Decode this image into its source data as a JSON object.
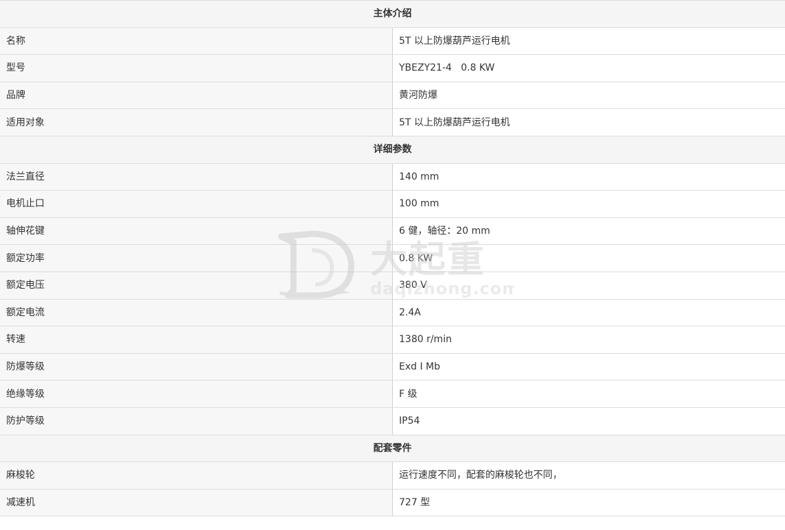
{
  "sections": [
    {
      "title": "主体介绍",
      "rows": [
        {
          "label": "名称",
          "value": "5T 以上防爆葫芦运行电机"
        },
        {
          "label": "型号",
          "value": "YBEZY21-4   0.8 KW"
        },
        {
          "label": "品牌",
          "value": "黄河防爆"
        },
        {
          "label": "适用对象",
          "value": "5T 以上防爆葫芦运行电机"
        }
      ]
    },
    {
      "title": "详细参数",
      "rows": [
        {
          "label": "法兰直径",
          "value": "140 mm"
        },
        {
          "label": "电机止口",
          "value": "100 mm"
        },
        {
          "label": "轴伸花键",
          "value": "6 健，轴径：20 mm"
        },
        {
          "label": "额定功率",
          "value": "0.8 KW"
        },
        {
          "label": "额定电压",
          "value": "380 V"
        },
        {
          "label": "额定电流",
          "value": "2.4A"
        },
        {
          "label": "转速",
          "value": "1380 r/min"
        },
        {
          "label": "防爆等级",
          "value": "Exd I Mb"
        },
        {
          "label": "绝缘等级",
          "value": "F 级"
        },
        {
          "label": "防护等级",
          "value": "IP54"
        }
      ]
    },
    {
      "title": "配套零件",
      "rows": [
        {
          "label": "麻梭轮",
          "value": "运行速度不同，配套的麻梭轮也不同，"
        },
        {
          "label": "减速机",
          "value": "727 型"
        }
      ]
    }
  ],
  "watermark": {
    "brand_text": "大起重",
    "domain_text": "daqizhong.com",
    "icon": "dq-logo-icon"
  }
}
